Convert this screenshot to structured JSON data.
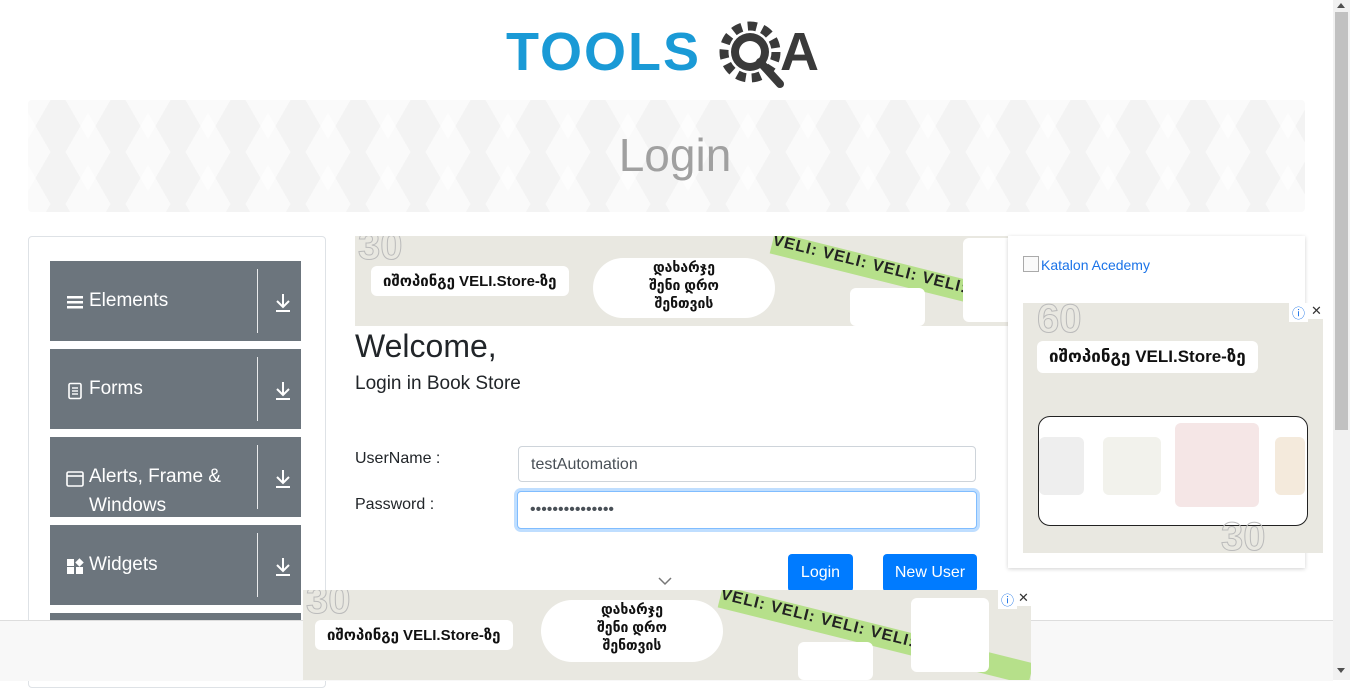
{
  "header": {
    "logo_text_left": "TOOLS",
    "logo_text_right": "A"
  },
  "banner": {
    "title": "Login"
  },
  "sidebar": {
    "groups": [
      {
        "label": "Elements",
        "icon": "menu-icon"
      },
      {
        "label": "Forms",
        "icon": "document-icon"
      },
      {
        "label": "Alerts, Frame &",
        "label2": "Windows",
        "icon": "window-icon"
      },
      {
        "label": "Widgets",
        "icon": "widgets-icon"
      }
    ]
  },
  "ads": {
    "shop_text": "იშოპინგე VELI.Store-ზე",
    "blob_line1": "დახარჯე",
    "blob_line2": "შენი დრო",
    "blob_line3": "შენთვის",
    "stripe_text": "VELI: VELI: VELI: VELI:",
    "num_30": "30",
    "num_60": "60",
    "info": "ⓘ",
    "close": "✕"
  },
  "right_panel": {
    "image_alt": "Katalon Acedemy"
  },
  "main": {
    "welcome": "Welcome,",
    "subtitle": "Login in Book Store",
    "username_label": "UserName :",
    "username_value": "testAutomation",
    "password_label": "Password :",
    "password_value": "•••••••••••••••",
    "login_button": "Login",
    "new_user_button": "New User"
  },
  "colors": {
    "accent": "#007bff",
    "sidebar": "#6c757d",
    "logo_blue": "#1a9ad6",
    "logo_dark": "#3a3a3a",
    "ad_green": "#b6e08a"
  }
}
